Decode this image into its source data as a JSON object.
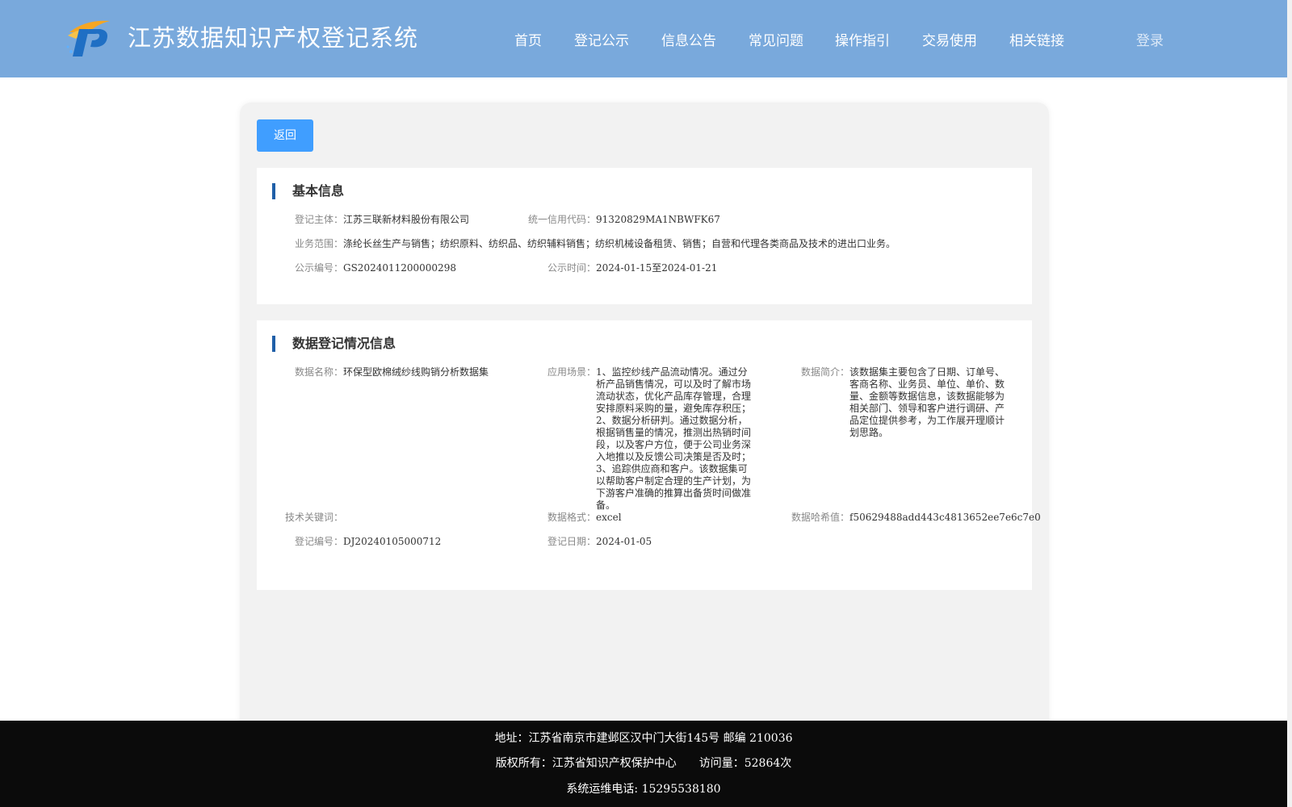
{
  "header": {
    "title": "江苏数据知识产权登记系统",
    "nav": [
      "首页",
      "登记公示",
      "信息公告",
      "常见问题",
      "操作指引",
      "交易使用",
      "相关链接"
    ],
    "login": "登录",
    "logo_colors": {
      "primary": "#1f6fc4",
      "accent": "#f5a623"
    }
  },
  "colors": {
    "header_bg": "#79a9dc",
    "button": "#409eff",
    "section_marker": "#1f5fa8",
    "footer_bg": "#0b0b0b"
  },
  "back_button": "返回",
  "basic_info": {
    "title": "基本信息",
    "subject_label": "登记主体：",
    "subject": "江苏三联新材料股份有限公司",
    "credit_code_label": "统一信用代码：",
    "credit_code": "91320829MA1NBWFK67",
    "scope_label": "业务范围：",
    "scope": "涤纶长丝生产与销售；纺织原料、纺织品、纺织辅料销售；纺织机械设备租赁、销售；自营和代理各类商品及技术的进出口业务。",
    "notice_no_label": "公示编号：",
    "notice_no": "GS2024011200000298",
    "notice_time_label": "公示时间：",
    "notice_time": "2024-01-15至2024-01-21"
  },
  "data_info": {
    "title": "数据登记情况信息",
    "name_label": "数据名称：",
    "name": "环保型欧棉绒纱线购销分析数据集",
    "scenario_label": "应用场景：",
    "scenario": "1、监控纱线产品流动情况。通过分析产品销售情况，可以及时了解市场流动状态，优化产品库存管理，合理安排原料采购的量，避免库存积压；2、数据分析研判。通过数据分析，根据销售量的情况，推测出热销时间段，以及客户方位，便于公司业务深入地推以及反馈公司决策是否及时；3、追踪供应商和客户。该数据集可以帮助客户制定合理的生产计划，为下游客户准确的推算出备货时间做准备。",
    "intro_label": "数据简介：",
    "intro": "该数据集主要包含了日期、订单号、客商名称、业务员、单位、单价、数量、金额等数据信息，该数据能够为相关部门、领导和客户进行调研、产品定位提供参考，为工作展开理顺计划思路。",
    "keywords_label": "技术关键词：",
    "keywords": "",
    "format_label": "数据格式：",
    "format": "excel",
    "hash_label": "数据哈希值：",
    "hash": "f50629488add443c4813652ee7e6c7e0",
    "reg_no_label": "登记编号：",
    "reg_no": "DJ20240105000712",
    "reg_date_label": "登记日期：",
    "reg_date": "2024-01-05"
  },
  "footer": {
    "address": "地址：江苏省南京市建邺区汉中门大街145号 邮编 210036",
    "copyright": "版权所有：江苏省知识产权保护中心　　访问量：52864次",
    "phone": "系统运维电话: 15295538180"
  }
}
